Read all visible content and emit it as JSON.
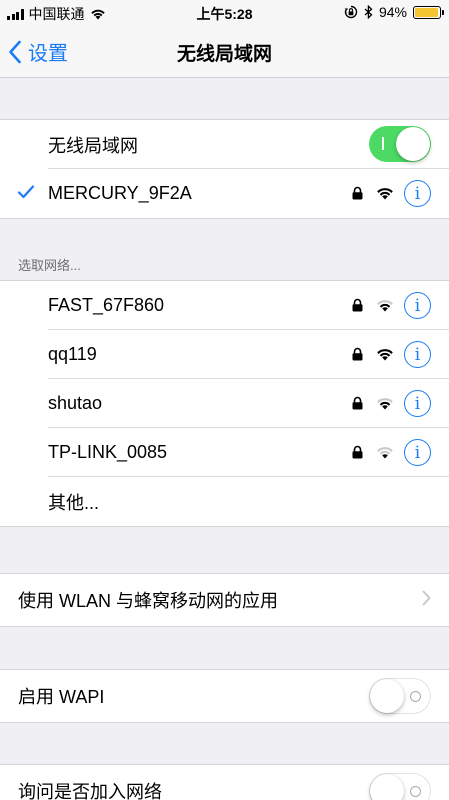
{
  "status_bar": {
    "carrier": "中国联通",
    "time": "上午5:28",
    "battery": "94%",
    "battery_level": 0.94,
    "icons": [
      "signal-icon",
      "wifi-icon",
      "orientation-lock-icon",
      "bluetooth-icon",
      "battery-icon"
    ]
  },
  "nav": {
    "back_label": "设置",
    "title": "无线局域网"
  },
  "wifi": {
    "toggle_label": "无线局域网",
    "enabled": true
  },
  "connected": {
    "name": "MERCURY_9F2A",
    "secured": true,
    "signal": "full"
  },
  "choose_network_header": "选取网络...",
  "networks": [
    {
      "name": "FAST_67F860",
      "secured": true,
      "signal": "medium"
    },
    {
      "name": "qq119",
      "secured": true,
      "signal": "full"
    },
    {
      "name": "shutao",
      "secured": true,
      "signal": "medium"
    },
    {
      "name": "TP-LINK_0085",
      "secured": true,
      "signal": "low"
    }
  ],
  "other_label": "其他...",
  "info_glyph": "i",
  "wlan_apps_label": "使用 WLAN 与蜂窝移动网的应用",
  "wapi": {
    "label": "启用 WAPI",
    "enabled": false
  },
  "ask_join": {
    "label": "询问是否加入网络",
    "enabled": false
  },
  "colors": {
    "accent": "#1a7cf6",
    "toggle_on": "#4cd964",
    "background": "#efeff4",
    "battery": "#f5c431"
  }
}
